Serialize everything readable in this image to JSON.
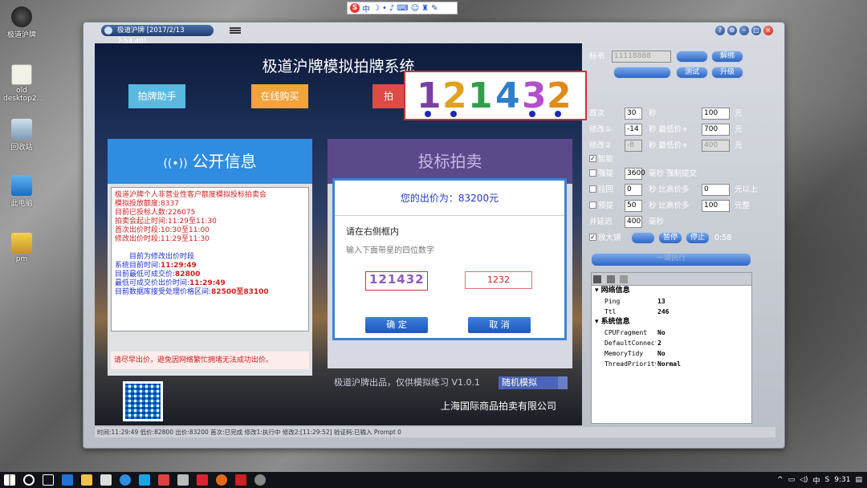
{
  "desktop": {
    "icons": [
      {
        "label": "极道沪牌"
      },
      {
        "label": "old desktop2..."
      },
      {
        "label": "回收站"
      },
      {
        "label": "此电脑"
      },
      {
        "label": "pm"
      }
    ]
  },
  "ime": {
    "logo": "S",
    "mode": "中"
  },
  "window": {
    "title": "极道沪牌 [2017/2/13 7:54:40]"
  },
  "app": {
    "title": "极道沪牌模拟拍牌系统",
    "nav": {
      "assistant": "拍牌助手",
      "buy": "在线购买",
      "third": "拍"
    },
    "captcha_big": [
      "1",
      "2",
      "1",
      "4",
      "3",
      "2"
    ],
    "public": {
      "header": "公开信息",
      "lines": [
        {
          "text": "极道沪牌个人非营业性客户额度模拟投标拍卖会",
          "c": "r"
        },
        {
          "text": "模拟投放额度:8337",
          "c": "r"
        },
        {
          "text": "目前已投标人数:226075",
          "c": "r"
        },
        {
          "text": "拍卖会起止时间:11:29至11:30",
          "c": "r"
        },
        {
          "text": "首次出价时段:10:30至11:00",
          "c": "r"
        },
        {
          "text": "修改出价时段:11:29至11:30",
          "c": "r"
        }
      ],
      "phase": "目前为修改出价时段",
      "sys_time_label": "系统目前时间:",
      "sys_time": "11:29:49",
      "min_price_label": "目前最低可成交价:",
      "min_price": "82800",
      "min_time_label": "最低可成交价出价时间:",
      "min_time": "11:29:49",
      "range_label": "目前数据库接受处理价格区间:",
      "range": "82500至83100",
      "warning": "请尽早出价，避免因网络繁忙拥堵无法成功出价。"
    },
    "bid": {
      "header": "投标拍卖",
      "footer": "极道沪牌出品，仅供模拟练习 V1.0.1",
      "mode": "随机模拟"
    },
    "dialog": {
      "price": "您的出价为：83200元",
      "line1": "请在右侧框内",
      "line2": "输入下面带星的四位数字",
      "captcha": "121432",
      "input_value": "1232",
      "confirm": "确  定",
      "cancel": "取  消"
    },
    "company": "上海国际商品拍卖有限公司"
  },
  "panel": {
    "biaoshu_label": "标书",
    "biaoshu_value": "11118888",
    "btn_hidden1": "",
    "btn_unbind": "解绑",
    "btn_hidden2": "",
    "btn_test": "测试",
    "btn_upgrade": "升级",
    "first_label": "首次",
    "first_sec": "30",
    "sec": "秒",
    "first_price": "100",
    "yuan": "元",
    "mod1_label": "修改①",
    "mod1_sec": "-14",
    "mod1_text": "秒 最低价+",
    "mod1_price": "700",
    "mod2_label": "修改②",
    "mod2_sec": "-8",
    "mod2_text": "秒 最低价+",
    "mod2_price": "400",
    "smart": "智能",
    "force_label": "强提",
    "force_ms": "3600",
    "force_text": "毫秒 强制提交",
    "pullback_label": "拉回",
    "pullback_sec": "0",
    "pullback_text": "秒 比高价多",
    "pullback_price": "0",
    "pullback_unit": "元以上",
    "preset_label": "预提",
    "preset_sec": "50",
    "preset_text": "秒 比高价多",
    "preset_price": "100",
    "preset_unit": "元整",
    "delay_label": "并延迟",
    "delay_ms": "400",
    "delay_unit": "毫秒",
    "magnifier": "放大镜",
    "pause": "暂停",
    "stop": "停止",
    "timer": "0:58",
    "wide_btn": "一键执行"
  },
  "props": {
    "sec1": "网络信息",
    "ping_k": "Ping",
    "ping_v": "13",
    "ttl_k": "Ttl",
    "ttl_v": "246",
    "sec2": "系统信息",
    "cpu_k": "CPUFragment",
    "cpu_v": "No",
    "dc_k": "DefaultConnectio",
    "dc_v": "2",
    "mt_k": "MemoryTidy",
    "mt_v": "No",
    "tp_k": "ThreadPriority",
    "tp_v": "Normal"
  },
  "status_bar": "时间:11:29:49  低价:82800  出价:83200  首次:已完成  修改1:执行中  修改2:[11:29:52]  验证码:已输入  Prompt 0",
  "taskbar": {
    "clock": "9:31",
    "lang": "中"
  }
}
